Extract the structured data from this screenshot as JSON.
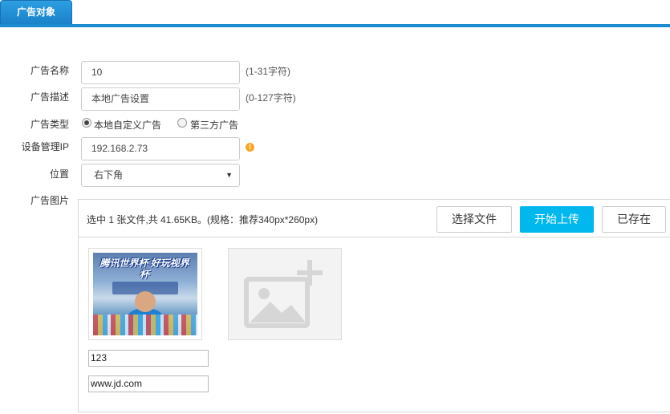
{
  "tab": {
    "label": "广告对象"
  },
  "form": {
    "name": {
      "label": "广告名称",
      "value": "10",
      "hint": "(1-31字符)"
    },
    "description": {
      "label": "广告描述",
      "value": "本地广告设置",
      "hint": "(0-127字符)"
    },
    "type": {
      "label": "广告类型",
      "options": [
        {
          "label": "本地自定义广告",
          "checked": true
        },
        {
          "label": "第三方广告",
          "checked": false
        }
      ]
    },
    "device_ip": {
      "label": "设备管理IP",
      "value": "192.168.2.73",
      "warn_icon": "!"
    },
    "position": {
      "label": "位置",
      "selected": "右下角",
      "caret": "▼"
    },
    "image": {
      "label": "广告图片"
    }
  },
  "upload": {
    "info": "选中 1 张文件,共 41.65KB。(规格：推荐340px*260px)",
    "buttons": {
      "choose": "选择文件",
      "start": "开始上传",
      "exists": "已存在"
    },
    "item": {
      "poster_title": "腾讯世界杯 好玩视界杯",
      "name_value": "123",
      "url_value": "www.jd.com"
    }
  },
  "colors": {
    "accent": "#1a8ccf",
    "primary_button": "#00b7ee",
    "warning": "#f5a623"
  },
  "icons": {
    "warning": "warning-icon",
    "add_image": "image-plus-icon"
  }
}
